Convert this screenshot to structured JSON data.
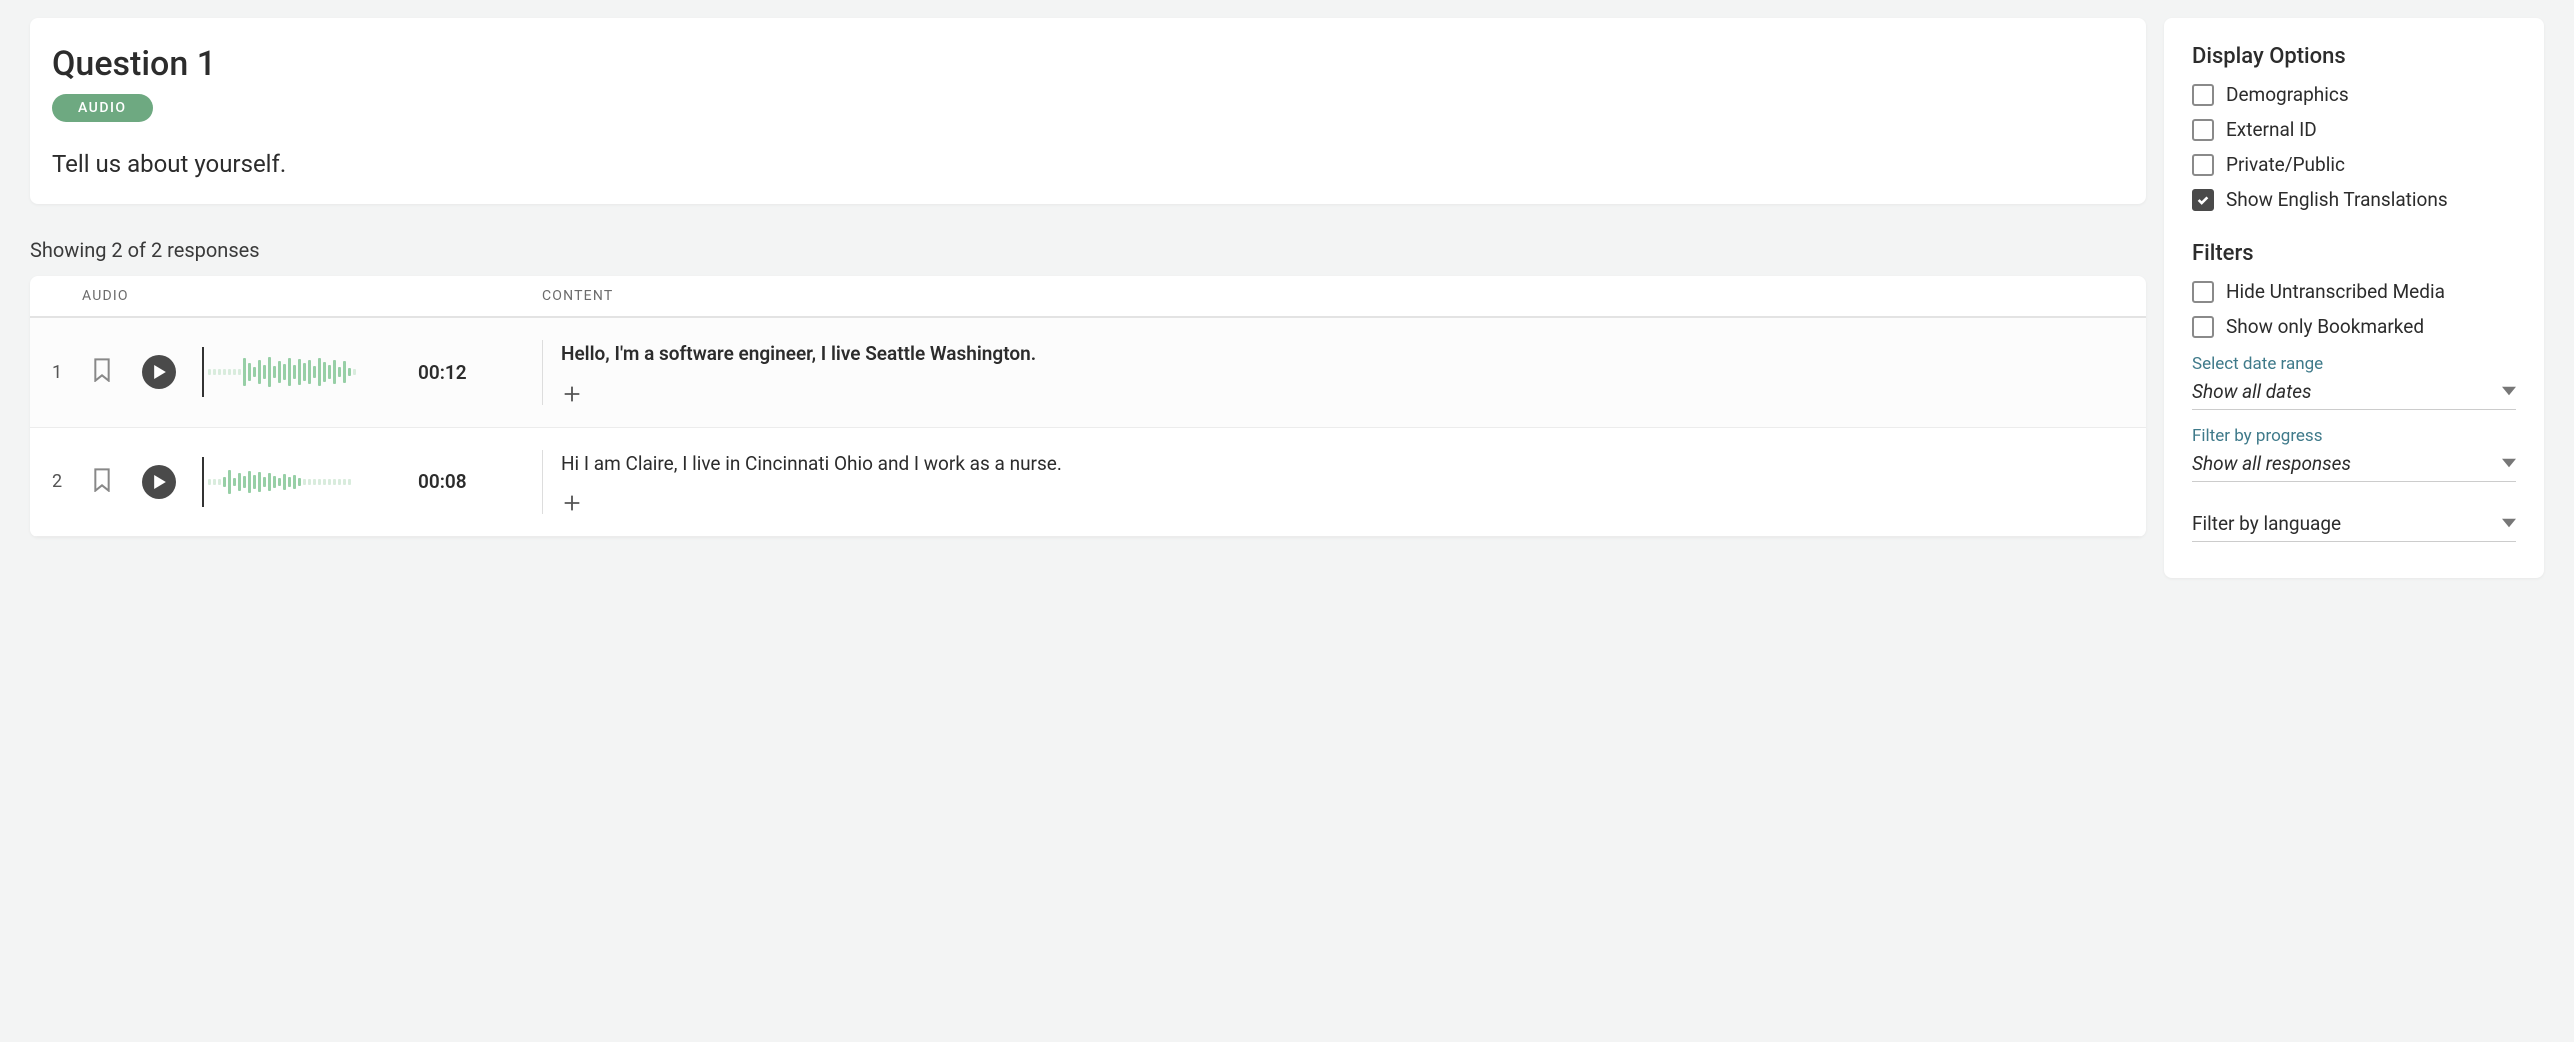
{
  "question": {
    "title": "Question 1",
    "badge": "AUDIO",
    "text": "Tell us about yourself."
  },
  "showing": "Showing 2 of 2 responses",
  "headers": {
    "audio": "AUDIO",
    "content": "CONTENT"
  },
  "rows": [
    {
      "index": "1",
      "duration": "00:12",
      "content": "Hello, I'm a software engineer, I live Seattle Washington."
    },
    {
      "index": "2",
      "duration": "00:08",
      "content": "Hi I am Claire, I live in Cincinnati Ohio and I work as a nurse."
    }
  ],
  "panel": {
    "display_options_title": "Display Options",
    "filters_title": "Filters",
    "options": {
      "demographics": "Demographics",
      "external_id": "External ID",
      "private_public": "Private/Public",
      "show_translations": "Show English Translations"
    },
    "filters": {
      "hide_untranscribed": "Hide Untranscribed Media",
      "show_bookmarked": "Show only Bookmarked"
    },
    "date_label": "Select date range",
    "date_value": "Show all dates",
    "progress_label": "Filter by progress",
    "progress_value": "Show all responses",
    "language_label": "Filter by language"
  }
}
